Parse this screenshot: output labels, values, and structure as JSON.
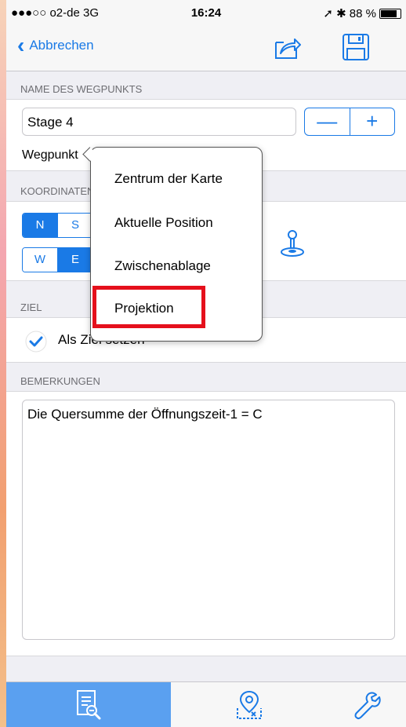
{
  "status_bar": {
    "carrier": "●●●○○ o2-de  3G",
    "time": "16:24",
    "battery": "➚ ✱ 88 %"
  },
  "nav": {
    "back_label": "Abbrechen",
    "icons": [
      "share-icon",
      "save-icon"
    ]
  },
  "name_section": {
    "header": "NAME DES WEGPUNKTS",
    "name_value": "Stage 4",
    "minus": "—",
    "plus": "+",
    "type_label": "Wegpunkt"
  },
  "coord_section": {
    "header": "KOORDINATEN",
    "lat_options": [
      "N",
      "S"
    ],
    "lat_selected": "N",
    "lon_options": [
      "W",
      "E"
    ],
    "lon_selected": "E"
  },
  "ziel_section": {
    "header": "ZIEL",
    "label": "Als Ziel setzen",
    "checked": true
  },
  "remarks_section": {
    "header": "BEMERKUNGEN",
    "text": "Die Quersumme der Öffnungszeit-1 = C"
  },
  "popup_menu": {
    "items": [
      "Zentrum der Karte",
      "Aktuelle Position",
      "Zwischenablage",
      "Projektion"
    ],
    "highlighted": "Projektion"
  },
  "tab_bar": {
    "tabs": [
      "details-icon",
      "map-pin-icon",
      "wrench-icon"
    ],
    "active_index": 0
  },
  "colors": {
    "accent": "#1a7ae6",
    "highlight": "#e5101c",
    "tab_active": "#5aa0f0"
  }
}
